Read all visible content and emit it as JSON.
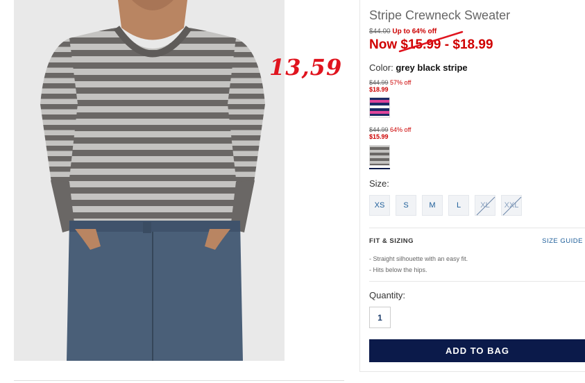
{
  "product": {
    "title": "Stripe Crewneck Sweater",
    "original_price": "$44.00",
    "discount_text": "Up to 64% off",
    "now_prefix": "Now",
    "now_price_low": "$15.99",
    "now_price_sep": "-",
    "now_price_high": "$18.99",
    "color_label": "Color:",
    "color_value": "grey black stripe"
  },
  "overlay": {
    "price_text": "13,59"
  },
  "variants": [
    {
      "orig": "$44.99",
      "discount": "57% off",
      "price": "$18.99",
      "swatch": "pink-navy-stripe"
    },
    {
      "orig": "$44.99",
      "discount": "64% off",
      "price": "$15.99",
      "swatch": "grey-black-stripe",
      "selected": true
    }
  ],
  "size": {
    "label": "Size:",
    "options": [
      {
        "label": "XS",
        "available": true
      },
      {
        "label": "S",
        "available": true
      },
      {
        "label": "M",
        "available": true
      },
      {
        "label": "L",
        "available": true
      },
      {
        "label": "XL",
        "available": false
      },
      {
        "label": "XXL",
        "available": false
      }
    ]
  },
  "fit": {
    "title": "FIT & SIZING",
    "guide_label": "SIZE GUIDE",
    "items": [
      "- Straight silhouette with an easy fit.",
      "- Hits below the hips."
    ]
  },
  "quantity": {
    "label": "Quantity:",
    "value": "1"
  },
  "cta": {
    "label": "ADD TO BAG"
  },
  "colors": {
    "sale_red": "#cc0000",
    "annotation_red": "#e0141e",
    "cta_navy": "#0b1a4a",
    "link_blue": "#1c5d99"
  }
}
